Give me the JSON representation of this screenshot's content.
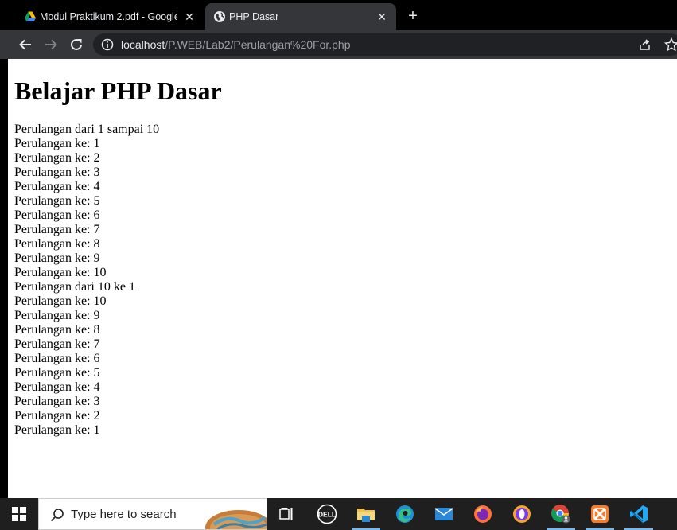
{
  "browser": {
    "tabs": [
      {
        "title": "Modul Praktikum 2.pdf - Google",
        "icon": "google-drive-icon",
        "active": false
      },
      {
        "title": "PHP Dasar",
        "icon": "globe-icon",
        "active": true
      }
    ],
    "new_tab_label": "+",
    "url": {
      "host": "localhost",
      "path": "/P.WEB/Lab2/Perulangan%20For.php"
    }
  },
  "page": {
    "heading": "Belajar PHP Dasar",
    "lines": [
      "Perulangan dari 1 sampai 10",
      "Perulangan ke: 1",
      "Perulangan ke: 2",
      "Perulangan ke: 3",
      "Perulangan ke: 4",
      "Perulangan ke: 5",
      "Perulangan ke: 6",
      "Perulangan ke: 7",
      "Perulangan ke: 8",
      "Perulangan ke: 9",
      "Perulangan ke: 10",
      "Perulangan dari 10 ke 1",
      "Perulangan ke: 10",
      "Perulangan ke: 9",
      "Perulangan ke: 8",
      "Perulangan ke: 7",
      "Perulangan ke: 6",
      "Perulangan ke: 5",
      "Perulangan ke: 4",
      "Perulangan ke: 3",
      "Perulangan ke: 2",
      "Perulangan ke: 1"
    ]
  },
  "taskbar": {
    "search_placeholder": "Type here to search",
    "apps": [
      "task-view-icon",
      "dell-icon",
      "file-explorer-icon",
      "edge-icon",
      "mail-icon",
      "firefox-icon",
      "opera-icon",
      "chrome-icon",
      "xampp-icon",
      "vscode-icon"
    ]
  },
  "colors": {
    "tab_active": "#35363a",
    "toolbar": "#35363a",
    "omnibox": "#202124",
    "taskbar": "#1f1f1f"
  }
}
